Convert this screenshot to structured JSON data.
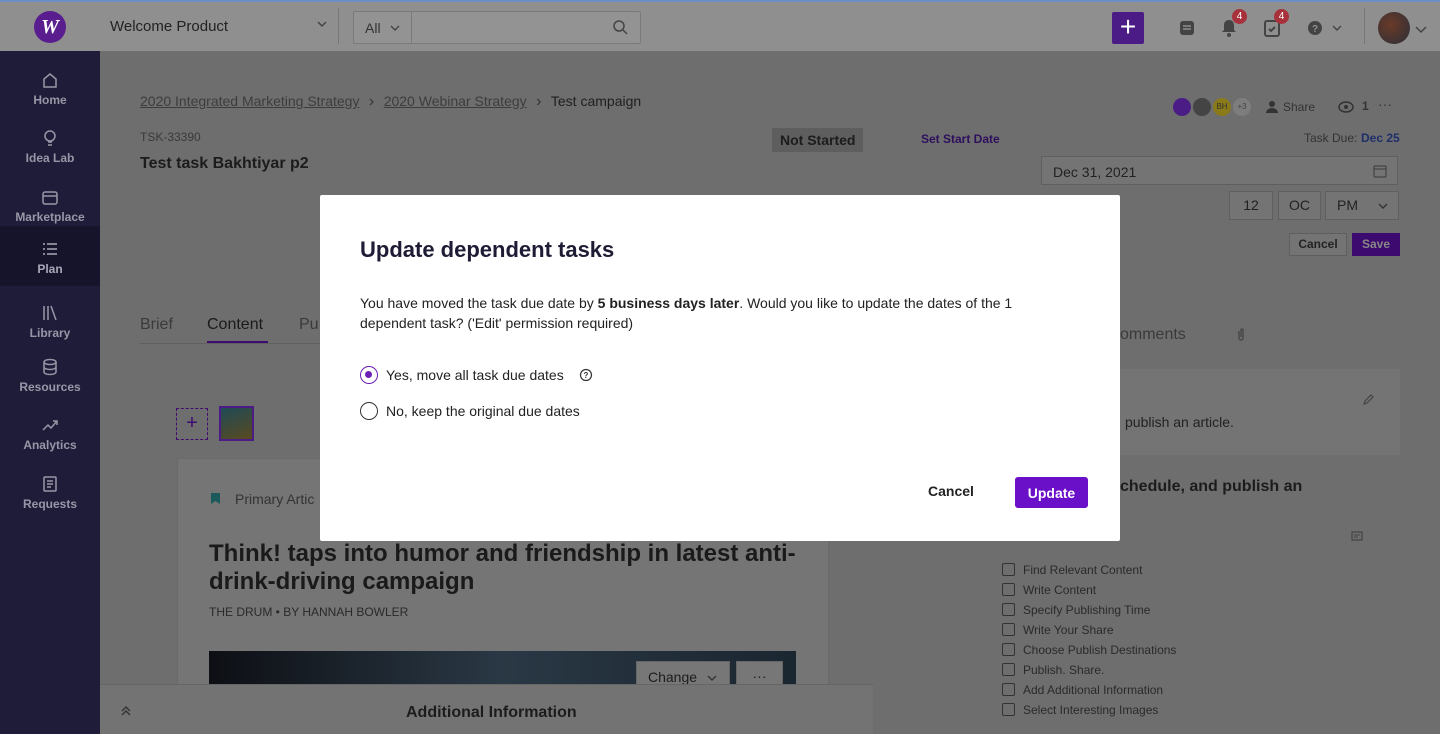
{
  "topbar": {
    "product_name": "Welcome Product",
    "search_scope": "All",
    "search_placeholder": "",
    "notifications_count": "4",
    "tasks_count": "4"
  },
  "sidebar": {
    "items": [
      {
        "label": "Home"
      },
      {
        "label": "Idea Lab"
      },
      {
        "label": "Marketplace"
      },
      {
        "label": "Plan"
      },
      {
        "label": "Library"
      },
      {
        "label": "Resources"
      },
      {
        "label": "Analytics"
      },
      {
        "label": "Requests"
      }
    ]
  },
  "breadcrumb": {
    "items": [
      "2020 Integrated Marketing Strategy",
      "2020 Webinar Strategy"
    ],
    "current": "Test campaign",
    "separator": "›"
  },
  "task": {
    "id": "TSK-33390",
    "title": "Test task Bakhtiyar p2",
    "status": "Not Started",
    "set_start_date": "Set Start Date",
    "due_label": "Task Due:",
    "due_value": "Dec 25",
    "due_date_input": "Dec 31, 2021",
    "hour": "12",
    "minute": "OC",
    "ampm": "PM",
    "cancel": "Cancel",
    "save": "Save"
  },
  "collaborators": {
    "initials_bh": "BH",
    "more": "+3",
    "share": "Share",
    "watchers": "1"
  },
  "tabs": [
    "Brief",
    "Content",
    "Pu"
  ],
  "right_panel": {
    "tab_comments": "omments",
    "text1": "publish an article.",
    "text2": "chedule, and publish an",
    "checklist": [
      "Find Relevant Content",
      "Write Content",
      "Specify Publishing Time",
      "Write Your Share",
      "Choose Publish Destinations",
      "Publish. Share.",
      "Add Additional Information",
      "Select Interesting Images"
    ]
  },
  "content": {
    "type_label": "Primary Artic",
    "headline": "Think! taps into humor and friendship in latest anti-drink-driving campaign",
    "byline": "THE DRUM • BY HANNAH BOWLER",
    "change": "Change",
    "more": "···"
  },
  "bottom_bar": {
    "label": "Additional Information"
  },
  "modal": {
    "title": "Update dependent tasks",
    "body_prefix": "You have moved the task due date by ",
    "body_bold": "5 business days later",
    "body_suffix": ". Would you like to update the dates of the 1 dependent task? ('Edit' permission required)",
    "option_yes": "Yes, move all task due dates",
    "option_no": "No, keep the original due dates",
    "cancel": "Cancel",
    "update": "Update"
  },
  "colors": {
    "accent": "#6b10c9",
    "sidebar_bg": "#1f1c39",
    "badge": "#d63c4b"
  }
}
